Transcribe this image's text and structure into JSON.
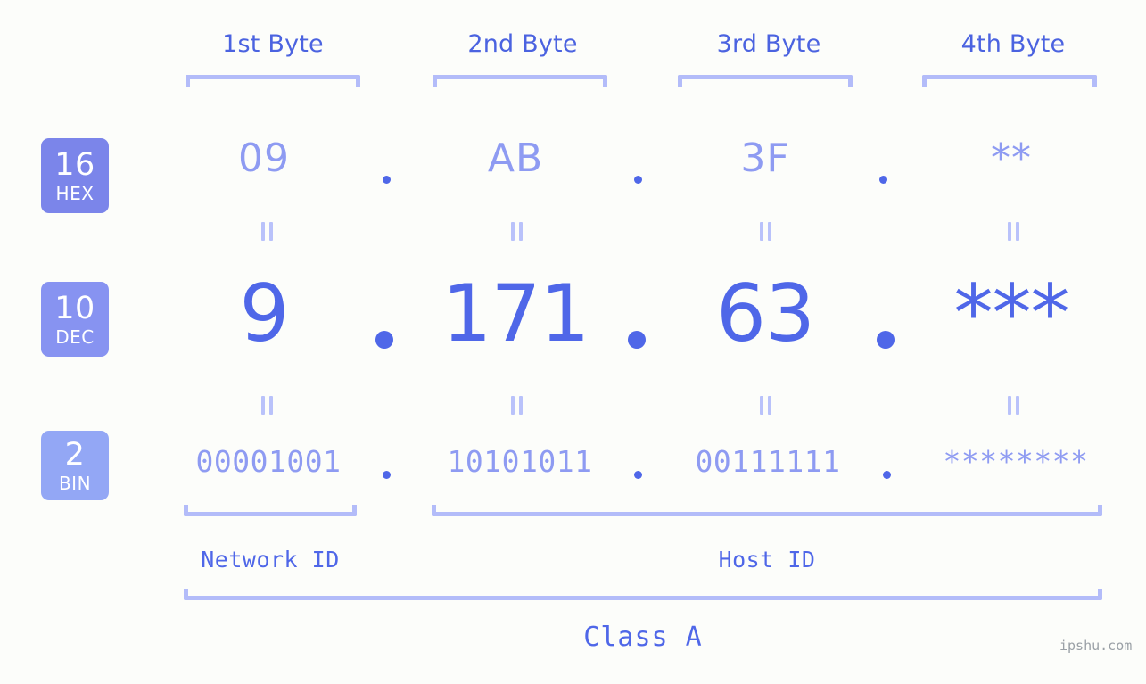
{
  "meta": {
    "background_color": "#fcfdfa",
    "accent_strong": "#4f67e8",
    "accent_soft": "#8e9bf2",
    "accent_pale": "#b3bcf9",
    "watermark": "ipshu.com"
  },
  "headers": [
    {
      "label": "1st Byte"
    },
    {
      "label": "2nd Byte"
    },
    {
      "label": "3rd Byte"
    },
    {
      "label": "4th Byte"
    }
  ],
  "bases": [
    {
      "num": "16",
      "label": "HEX",
      "color": "#7b85ea"
    },
    {
      "num": "10",
      "label": "DEC",
      "color": "#8793f1"
    },
    {
      "num": "2",
      "label": "BIN",
      "color": "#93a7f5"
    }
  ],
  "rows": {
    "hex": {
      "base_num": "16",
      "base_label": "HEX",
      "values": [
        "09",
        "AB",
        "3F",
        "**"
      ],
      "separator": "."
    },
    "dec": {
      "base_num": "10",
      "base_label": "DEC",
      "values": [
        "9",
        "171",
        "63",
        "***"
      ],
      "separator": "."
    },
    "bin": {
      "base_num": "2",
      "base_label": "BIN",
      "values": [
        "00001001",
        "10101011",
        "00111111",
        "********"
      ],
      "separator": "."
    }
  },
  "equals_marker": "=",
  "footer": {
    "network_id": "Network ID",
    "host_id": "Host ID",
    "class": "Class A"
  }
}
